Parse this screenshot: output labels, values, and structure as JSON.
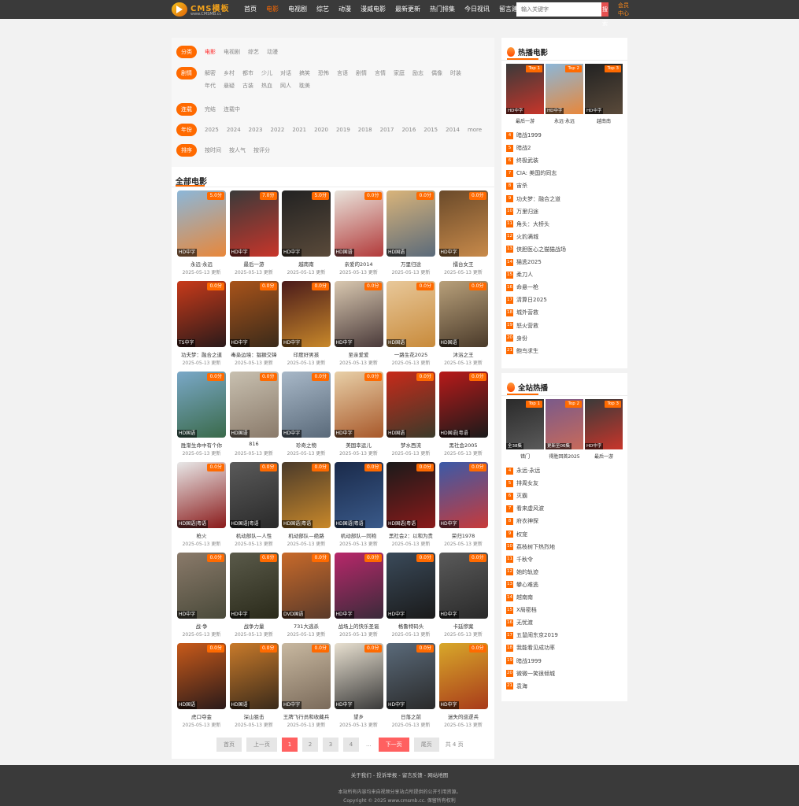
{
  "site": {
    "logo_text": "CMS模板",
    "logo_sub": "www.CMSMB.cc",
    "search_placeholder": "输入关键字",
    "search_button": "搜索",
    "member": "会员中心"
  },
  "nav": [
    "首页",
    "电影",
    "电视剧",
    "综艺",
    "动漫",
    "漫威电影",
    "最新更新",
    "热门排集",
    "今日视讯",
    "留言建议"
  ],
  "nav_active": 1,
  "filters": [
    {
      "key": "分类",
      "options": [
        "电影",
        "电视剧",
        "综艺",
        "动漫"
      ],
      "active": 0
    },
    {
      "key": "剧情",
      "options": [
        "解密",
        "乡村",
        "都市",
        "少儿",
        "对话",
        "搞笑",
        "恐怖",
        "言语",
        "剧情",
        "言情",
        "家庭",
        "励志",
        "偶像",
        "时装",
        "年代",
        "悬疑",
        "古装",
        "热血",
        "网人",
        "耽美"
      ],
      "active": -1
    },
    {
      "key": "连载",
      "options": [
        "完结",
        "连载中"
      ],
      "active": -1
    },
    {
      "key": "年份",
      "options": [
        "2025",
        "2024",
        "2023",
        "2022",
        "2021",
        "2020",
        "2019",
        "2018",
        "2017",
        "2016",
        "2015",
        "2014",
        "more"
      ],
      "active": -1
    },
    {
      "key": "排序",
      "options": [
        "按时间",
        "按人气",
        "按评分"
      ],
      "active": -1
    }
  ],
  "section_title": "全部电影",
  "movies": [
    {
      "title": "永远·永远",
      "score": "5.0分",
      "quality": "HD中字",
      "date": "2025-05-13 更新",
      "colors": [
        "#8bb7d9",
        "#e8873a"
      ]
    },
    {
      "title": "最后一游",
      "score": "7.0分",
      "quality": "HD中字",
      "date": "2025-05-13 更新",
      "colors": [
        "#3a3a3a",
        "#c8352a"
      ]
    },
    {
      "title": "越南南",
      "score": "5.0分",
      "quality": "HD中字",
      "date": "2025-05-13 更新",
      "colors": [
        "#222",
        "#5a4a3a"
      ]
    },
    {
      "title": "亲爱的2014",
      "score": "0.0分",
      "quality": "HD国语",
      "date": "2025-05-13 更新",
      "colors": [
        "#e9e4dc",
        "#b23a3a"
      ]
    },
    {
      "title": "万里归途",
      "score": "0.0分",
      "quality": "HD国语",
      "date": "2025-05-13 更新",
      "colors": [
        "#d9b47a",
        "#5a6a7a"
      ]
    },
    {
      "title": "擂台女王",
      "score": "0.0分",
      "quality": "HD中字",
      "date": "2025-05-13 更新",
      "colors": [
        "#6a4a2a",
        "#c88a4a"
      ]
    },
    {
      "title": "功夫梦：融合之道",
      "score": "0.0分",
      "quality": "TS中字",
      "date": "2025-05-13 更新",
      "colors": [
        "#c83a1a",
        "#2a1a1a"
      ]
    },
    {
      "title": "毒枭边境：猖獗交锋",
      "score": "0.0分",
      "quality": "HD中字",
      "date": "2025-05-13 更新",
      "colors": [
        "#a8531a",
        "#3a2a1a"
      ]
    },
    {
      "title": "印度好男孩",
      "score": "0.0分",
      "quality": "HD中字",
      "date": "2025-05-13 更新",
      "colors": [
        "#4a1a1a",
        "#c8882a"
      ]
    },
    {
      "title": "至亲爱爱",
      "score": "0.0分",
      "quality": "HD中字",
      "date": "2025-05-13 更新",
      "colors": [
        "#d9c8b0",
        "#4a3a3a"
      ]
    },
    {
      "title": "一路生花2025",
      "score": "0.0分",
      "quality": "HD国语",
      "date": "2025-05-13 更新",
      "colors": [
        "#e8c89a",
        "#c88a3a"
      ]
    },
    {
      "title": "沐浴之王",
      "score": "0.0分",
      "quality": "HD国语",
      "date": "2025-05-13 更新",
      "colors": [
        "#b8a07a",
        "#4a3a2a"
      ]
    },
    {
      "title": "胜渐生命中有个你",
      "score": "0.0分",
      "quality": "HD国语",
      "date": "2025-05-13 更新",
      "colors": [
        "#7aa8c8",
        "#3a6a4a"
      ]
    },
    {
      "title": "816",
      "score": "0.0分",
      "quality": "HD国语",
      "date": "2025-05-13 更新",
      "colors": [
        "#c8c0b0",
        "#8a7a6a"
      ]
    },
    {
      "title": "珍奇之物",
      "score": "0.0分",
      "quality": "HD中字",
      "date": "2025-05-13 更新",
      "colors": [
        "#a8b8c8",
        "#5a6a7a"
      ]
    },
    {
      "title": "美国幸运儿",
      "score": "0.0分",
      "quality": "HD中字",
      "date": "2025-05-13 更新",
      "colors": [
        "#e8d0a8",
        "#a8582a"
      ]
    },
    {
      "title": "梦水西流",
      "score": "0.0分",
      "quality": "HD国语",
      "date": "2025-05-13 更新",
      "colors": [
        "#c82a1a",
        "#3a3a2a"
      ]
    },
    {
      "title": "黑社会2005",
      "score": "0.0分",
      "quality": "HD国语|粤语",
      "date": "2025-05-13 更新",
      "colors": [
        "#b81a1a",
        "#1a1a1a"
      ]
    },
    {
      "title": "枪火",
      "score": "0.0分",
      "quality": "HD国语|粤语",
      "date": "2025-05-13 更新",
      "colors": [
        "#e8e8e8",
        "#8a1a1a"
      ]
    },
    {
      "title": "机动部队—人性",
      "score": "0.0分",
      "quality": "HD国语|粤语",
      "date": "2025-05-13 更新",
      "colors": [
        "#5a5a5a",
        "#2a2a2a"
      ]
    },
    {
      "title": "机动部队—绝路",
      "score": "0.0分",
      "quality": "HD国语|粤语",
      "date": "2025-05-13 更新",
      "colors": [
        "#4a3a2a",
        "#c8882a"
      ]
    },
    {
      "title": "机动部队—同袍",
      "score": "0.0分",
      "quality": "HD国语|粤语",
      "date": "2025-05-13 更新",
      "colors": [
        "#1a2a4a",
        "#3a5a8a"
      ]
    },
    {
      "title": "黑社会2：以和为贵",
      "score": "0.0分",
      "quality": "HD国语|粤语",
      "date": "2025-05-13 更新",
      "colors": [
        "#1a1a1a",
        "#8a1a1a"
      ]
    },
    {
      "title": "荣归1978",
      "score": "0.0分",
      "quality": "HD中字",
      "date": "2025-05-13 更新",
      "colors": [
        "#3a5aa8",
        "#c83a3a"
      ]
    },
    {
      "title": "战·争",
      "score": "0.0分",
      "quality": "HD中字",
      "date": "2025-05-13 更新",
      "colors": [
        "#8a7a6a",
        "#4a4a3a"
      ]
    },
    {
      "title": "战争力量",
      "score": "0.0分",
      "quality": "HD中字",
      "date": "2025-05-13 更新",
      "colors": [
        "#5a5a4a",
        "#2a2a1a"
      ]
    },
    {
      "title": "731大逃杀",
      "score": "0.0分",
      "quality": "DVD国语",
      "date": "2025-05-13 更新",
      "colors": [
        "#c86a2a",
        "#5a3a2a"
      ]
    },
    {
      "title": "战场上的快乐圣诞",
      "score": "0.0分",
      "quality": "HD中字",
      "date": "2025-05-13 更新",
      "colors": [
        "#b8286a",
        "#3a2a3a"
      ]
    },
    {
      "title": "格鲁特码头",
      "score": "0.0分",
      "quality": "HD中字",
      "date": "2025-05-13 更新",
      "colors": [
        "#3a4a5a",
        "#1a1a1a"
      ]
    },
    {
      "title": "卡廷惨案",
      "score": "0.0分",
      "quality": "HD中字",
      "date": "2025-05-13 更新",
      "colors": [
        "#5a5a5a",
        "#2a2a2a"
      ]
    },
    {
      "title": "虎口夺金",
      "score": "0.0分",
      "quality": "HD国语",
      "date": "2025-05-13 更新",
      "colors": [
        "#c85a1a",
        "#2a1a1a"
      ]
    },
    {
      "title": "深山狙击",
      "score": "0.0分",
      "quality": "HD国语",
      "date": "2025-05-13 更新",
      "colors": [
        "#c87a2a",
        "#3a2a1a"
      ]
    },
    {
      "title": "王牌飞行员和收藏兵",
      "score": "0.0分",
      "quality": "HD中字",
      "date": "2025-05-13 更新",
      "colors": [
        "#c8b8a0",
        "#7a6a5a"
      ]
    },
    {
      "title": "望乡",
      "score": "0.0分",
      "quality": "HD中字",
      "date": "2025-05-13 更新",
      "colors": [
        "#e8e0d0",
        "#3a3a3a"
      ]
    },
    {
      "title": "日落之前",
      "score": "0.0分",
      "quality": "HD中字",
      "date": "2025-05-13 更新",
      "colors": [
        "#5a6a7a",
        "#2a2a2a"
      ]
    },
    {
      "title": "迷失的巡逻兵",
      "score": "0.0分",
      "quality": "HD中字",
      "date": "2025-05-13 更新",
      "colors": [
        "#d8a82a",
        "#a83a1a"
      ]
    }
  ],
  "pager": {
    "first": "首页",
    "prev": "上一页",
    "pages": [
      "1",
      "2",
      "3",
      "4"
    ],
    "current": "1",
    "ellipsis": "...",
    "next": "下一页",
    "last": "尾页",
    "total": "共 4 页"
  },
  "sidebar": [
    {
      "title": "热播电影",
      "top3": [
        {
          "badge": "Top 1",
          "quality": "HD中字",
          "name": "最后一游",
          "colors": [
            "#3a3a3a",
            "#c8352a"
          ]
        },
        {
          "badge": "Top 2",
          "quality": "HD中字",
          "name": "永远·永远",
          "colors": [
            "#8bb7d9",
            "#e8873a"
          ]
        },
        {
          "badge": "Top 3",
          "quality": "HD中字",
          "name": "越南南",
          "colors": [
            "#222",
            "#5a4a3a"
          ]
        }
      ],
      "list": [
        {
          "rank": "4",
          "name": "暗战1999"
        },
        {
          "rank": "5",
          "name": "暗战2"
        },
        {
          "rank": "6",
          "name": "终极武装"
        },
        {
          "rank": "7",
          "name": "CIA: 美国的同志"
        },
        {
          "rank": "8",
          "name": "宙杀"
        },
        {
          "rank": "9",
          "name": "功夫梦：融合之道"
        },
        {
          "rank": "10",
          "name": "万里归途"
        },
        {
          "rank": "11",
          "name": "角头：大桥头"
        },
        {
          "rank": "12",
          "name": "火豹满城"
        },
        {
          "rank": "13",
          "name": "侠胆医心之猫猫战场"
        },
        {
          "rank": "14",
          "name": "猫逃2025"
        },
        {
          "rank": "15",
          "name": "柔刀人"
        },
        {
          "rank": "16",
          "name": "命悬一枪"
        },
        {
          "rank": "17",
          "name": "清算日2025"
        },
        {
          "rank": "18",
          "name": "城外营救"
        },
        {
          "rank": "19",
          "name": "怒火营救"
        },
        {
          "rank": "20",
          "name": "身份"
        },
        {
          "rank": "21",
          "name": "鲍鸟求生"
        }
      ]
    },
    {
      "title": "全站热播",
      "top3": [
        {
          "badge": "Top 1",
          "quality": "全38集",
          "name": "错门",
          "colors": [
            "#2a2a2a",
            "#5a5a5a"
          ]
        },
        {
          "badge": "Top 2",
          "quality": "更新至06集",
          "name": "得胜回首2025",
          "colors": [
            "#7a5a8a",
            "#c86a5a"
          ]
        },
        {
          "badge": "Top 3",
          "quality": "HD中字",
          "name": "最后一游",
          "colors": [
            "#3a3a3a",
            "#c8352a"
          ]
        }
      ],
      "list": [
        {
          "rank": "4",
          "name": "永远·永远"
        },
        {
          "rank": "5",
          "name": "排周女友"
        },
        {
          "rank": "6",
          "name": "灭霸"
        },
        {
          "rank": "7",
          "name": "看来虚风波"
        },
        {
          "rank": "8",
          "name": "府衣神探"
        },
        {
          "rank": "9",
          "name": "权宠"
        },
        {
          "rank": "10",
          "name": "荔枝树下热烈地"
        },
        {
          "rank": "11",
          "name": "千秋令"
        },
        {
          "rank": "12",
          "name": "她的轨迹"
        },
        {
          "rank": "13",
          "name": "攀心难逃"
        },
        {
          "rank": "14",
          "name": "越南南"
        },
        {
          "rank": "15",
          "name": "X局密档"
        },
        {
          "rank": "16",
          "name": "无忧渡"
        },
        {
          "rank": "17",
          "name": "五鼠闹东京2019"
        },
        {
          "rank": "18",
          "name": "我能看见成功率"
        },
        {
          "rank": "19",
          "name": "暗战1999"
        },
        {
          "rank": "20",
          "name": "微微一笑很倾城"
        },
        {
          "rank": "21",
          "name": "袁海"
        }
      ]
    }
  ],
  "footer": {
    "links": "关于我们 - 投诉举报 - 留言反馈 - 网站地图",
    "line1": "本站所有内容均来自视频分享站点所提供的公开引用资源。",
    "line2": "Copyright © 2025 www.cmsmb.cc. 保留所有权利"
  }
}
